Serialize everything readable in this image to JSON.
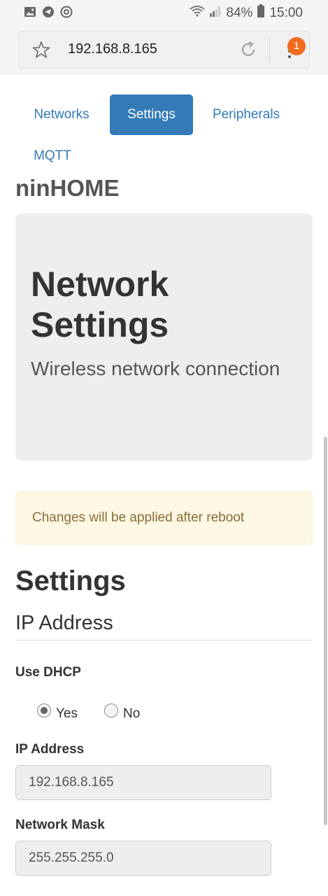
{
  "status_bar": {
    "battery": "84%",
    "time": "15:00",
    "left_icons": [
      "image-icon",
      "telegram-icon",
      "at-sync-icon"
    ],
    "right_icons": [
      "wifi-icon",
      "signal-icon",
      "battery-icon"
    ]
  },
  "browser": {
    "url": "192.168.8.165",
    "menu_badge": "1"
  },
  "nav": {
    "tabs": [
      {
        "label": "Networks",
        "active": false
      },
      {
        "label": "Settings",
        "active": true
      },
      {
        "label": "Peripherals",
        "active": false
      },
      {
        "label": "MQTT",
        "active": false
      }
    ]
  },
  "brand": "ninHOME",
  "jumbotron": {
    "title": "Network Settings",
    "subtitle": "Wireless network connection"
  },
  "alert": {
    "message": "Changes will be applied after reboot"
  },
  "form": {
    "heading": "Settings",
    "section_title": "IP Address",
    "dhcp_label": "Use DHCP",
    "dhcp_options": [
      {
        "label": "Yes",
        "checked": true
      },
      {
        "label": "No",
        "checked": false
      }
    ],
    "ip_label": "IP Address",
    "ip_value": "192.168.8.165",
    "mask_label": "Network Mask",
    "mask_value": "255.255.255.0"
  },
  "colors": {
    "primary": "#337ab7",
    "alert_bg": "#fcf8e3",
    "alert_text": "#8a6d3b",
    "badge": "#f26b1d"
  }
}
